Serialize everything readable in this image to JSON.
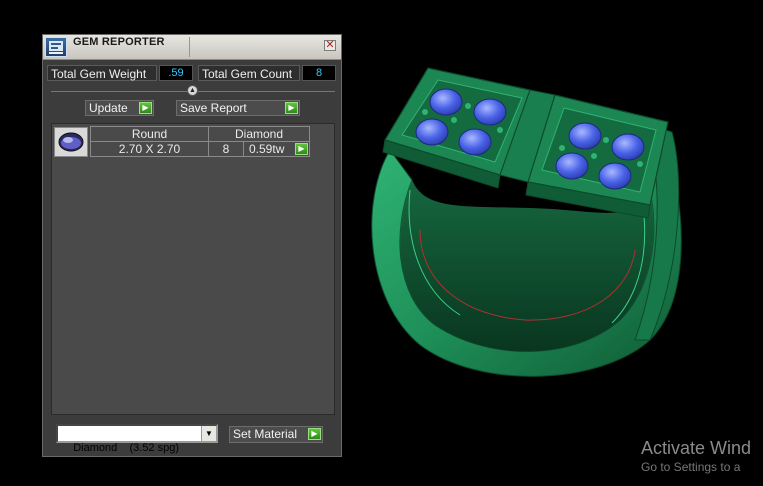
{
  "window": {
    "title": "GEM REPORTER",
    "close_glyph": "✕"
  },
  "stats": {
    "weight_label": "Total Gem Weight",
    "weight_value": ".59",
    "count_label": "Total Gem Count",
    "count_value": "8"
  },
  "actions": {
    "update_label": "Update",
    "save_label": "Save Report",
    "go_glyph": "▶"
  },
  "gems": [
    {
      "icon": "round-gem-icon",
      "shape": "Round",
      "size": "2.70 X 2.70",
      "material": "Diamond",
      "count": "8",
      "weight": "0.59tw"
    }
  ],
  "material": {
    "selected": "Diamond    (3.52 spg)",
    "set_label": "Set Material",
    "dropdown_glyph": "▼"
  },
  "viewport": {
    "object": "ring-with-blue-gems",
    "metal_color": "#1f8a55",
    "gem_color": "#4a63e8"
  },
  "os_watermark": {
    "line1": "Activate Wind",
    "line2": "Go to Settings to a"
  }
}
